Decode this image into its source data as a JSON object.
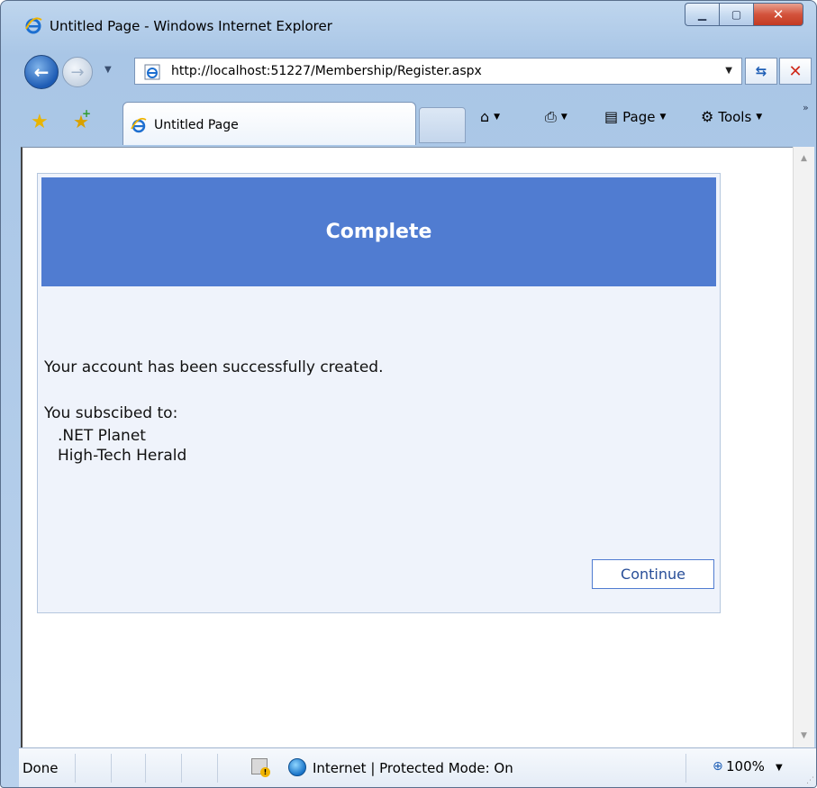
{
  "window": {
    "title": "Untitled Page - Windows Internet Explorer",
    "minimize_icon": "minimize-icon",
    "maximize_icon": "maximize-icon",
    "close_icon": "close-icon"
  },
  "navigation": {
    "url": "http://localhost:51227/Membership/Register.aspx"
  },
  "tab": {
    "label": "Untitled Page"
  },
  "command_bar": {
    "page_label": "Page",
    "tools_label": "Tools"
  },
  "wizard": {
    "header": "Complete",
    "message": "Your account has been successfully created.",
    "subscriptions_label": "You subscibed to:",
    "subscriptions": [
      ".NET Planet",
      "High-Tech Herald"
    ],
    "continue_label": "Continue"
  },
  "status_bar": {
    "status": "Done",
    "zone": "Internet | Protected Mode: On",
    "zoom": "100%"
  },
  "colors": {
    "header_bg": "#507cd1",
    "wizard_bg": "#eff3fb",
    "button_text": "#284e98"
  }
}
